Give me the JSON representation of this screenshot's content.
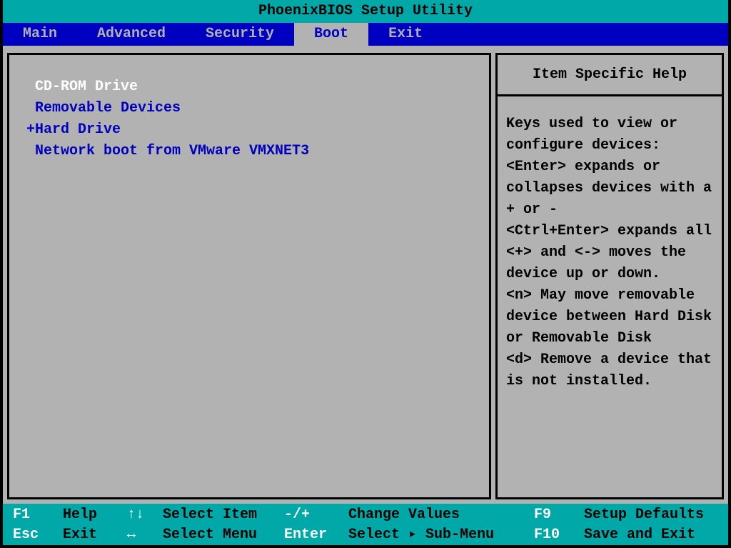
{
  "title": "PhoenixBIOS Setup Utility",
  "menu": {
    "items": [
      "Main",
      "Advanced",
      "Security",
      "Boot",
      "Exit"
    ],
    "active_index": 3
  },
  "boot": {
    "items": [
      {
        "prefix": " ",
        "label": "CD-ROM Drive",
        "selected": true
      },
      {
        "prefix": " ",
        "label": "Removable Devices",
        "selected": false
      },
      {
        "prefix": "+",
        "label": "Hard Drive",
        "selected": false
      },
      {
        "prefix": " ",
        "label": "Network boot from VMware VMXNET3",
        "selected": false
      }
    ]
  },
  "help": {
    "header": "Item Specific Help",
    "body": "Keys used to view or configure devices:\n<Enter> expands or collapses devices with a + or -\n<Ctrl+Enter> expands all\n<+> and <-> moves the device up or down.\n<n> May move removable device between Hard Disk or Removable Disk\n<d> Remove a device that is not installed."
  },
  "footer": {
    "row1": {
      "k1": "F1",
      "a1": "Help",
      "k2": "↑↓",
      "a2": "Select Item",
      "k3": "-/+",
      "a3": "Change Values",
      "k4": "F9",
      "a4": "Setup Defaults"
    },
    "row2": {
      "k1": "Esc",
      "a1": "Exit",
      "k2": "↔",
      "a2": "Select Menu",
      "k3": "Enter",
      "a3": "Select ▸ Sub-Menu",
      "k4": "F10",
      "a4": "Save and Exit"
    }
  }
}
